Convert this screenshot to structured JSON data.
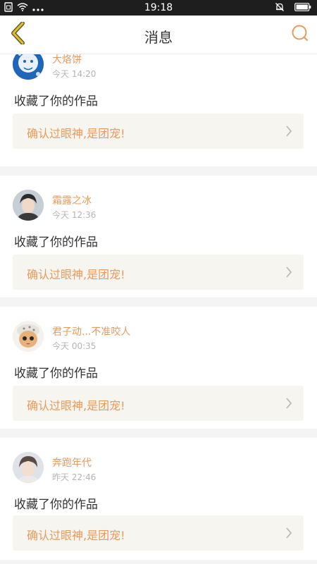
{
  "status_bar": {
    "time": "19:18",
    "left_icons": [
      "sim-icon",
      "wifi-icon",
      "more-dots-icon"
    ],
    "right_icons": [
      "mute-bell-icon",
      "battery-icon"
    ]
  },
  "header": {
    "title": "消息",
    "back_icon": "chevron-left-icon",
    "search_icon": "search-icon",
    "accent_color": "#e99a5c"
  },
  "messages": [
    {
      "user": "大烙饼",
      "time": "今天 14:20",
      "action": "收藏了你的作品",
      "work_title": "确认过眼神,是团宠!"
    },
    {
      "user": "霜露之冰",
      "time": "今天 12:36",
      "action": "收藏了你的作品",
      "work_title": "确认过眼神,是团宠!"
    },
    {
      "user": "君子动...不准咬人",
      "time": "今天 00:35",
      "action": "收藏了你的作品",
      "work_title": "确认过眼神,是团宠!"
    },
    {
      "user": "奔跑年代",
      "time": "昨天 22:46",
      "action": "收藏了你的作品",
      "work_title": "确认过眼神,是团宠!"
    }
  ]
}
